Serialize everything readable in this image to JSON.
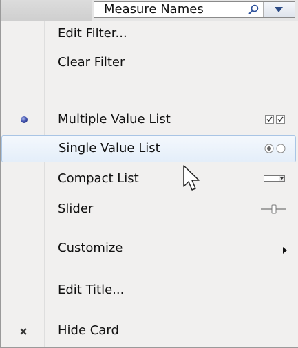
{
  "header": {
    "title": "Measure Names",
    "icons": {
      "search": "search-icon",
      "dropdown": "chevron-down-icon"
    }
  },
  "menu": {
    "edit_filter": "Edit Filter...",
    "clear_filter": "Clear Filter",
    "multiple_value_list": "Multiple Value List",
    "single_value_list": "Single Value List",
    "compact_list": "Compact List",
    "slider": "Slider",
    "customize": "Customize",
    "edit_title": "Edit Title...",
    "hide_card": "Hide Card"
  },
  "state": {
    "selected": "Multiple Value List",
    "hovered": "Single Value List"
  },
  "colors": {
    "highlight_border": "#a9c5e5",
    "highlight_fill": "#e4eef9",
    "radio_bullet": "#3f4fa8"
  }
}
